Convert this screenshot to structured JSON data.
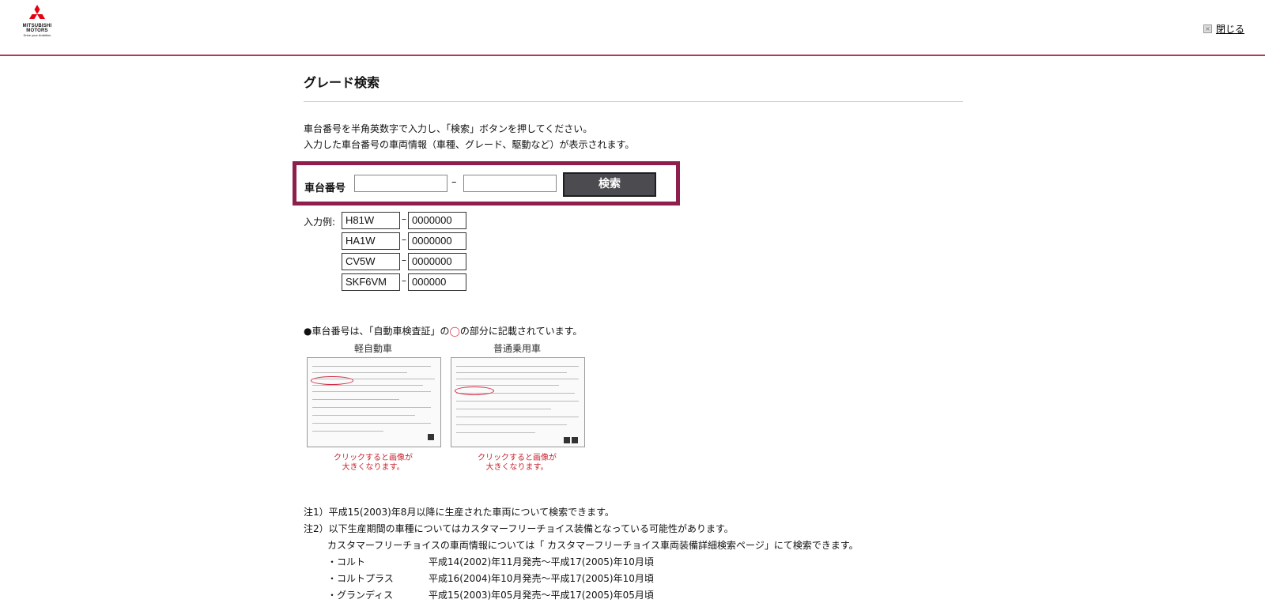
{
  "header": {
    "brand": "MITSUBISHI\nMOTORS",
    "brand_line1": "MITSUBISHI",
    "brand_line2": "MOTORS",
    "tagline": "Drive your Ambition",
    "close_label": "閉じる",
    "accent_color": "#b03a5b"
  },
  "page": {
    "title": "グレード検索",
    "intro_line1": "車台番号を半角英数字で入力し、「検索」ボタンを押してください。",
    "intro_line2": "入力した車台番号の車両情報（車種、グレード、駆動など）が表示されます。"
  },
  "search": {
    "label": "車台番号",
    "field1_value": "",
    "field2_value": "",
    "separator": "–",
    "button_label": "検索",
    "box_color": "#8e1f4c"
  },
  "examples": {
    "label": "入力例:",
    "rows": [
      {
        "prefix": "H81W",
        "number": "0000000"
      },
      {
        "prefix": "HA1W",
        "number": "0000000"
      },
      {
        "prefix": "CV5W",
        "number": "0000000"
      },
      {
        "prefix": "SKF6VM",
        "number": "000000"
      }
    ]
  },
  "certificate": {
    "heading_pre": "●車台番号は、「自動車検査証」の",
    "heading_mark": "◯",
    "heading_post": "の部分に記載されています。",
    "items": [
      {
        "title": "軽自動車",
        "caption1": "クリックすると画像が",
        "caption2": "大きくなります。"
      },
      {
        "title": "普通乗用車",
        "caption1": "クリックすると画像が",
        "caption2": "大きくなります。"
      }
    ]
  },
  "notes": {
    "note1": "注1）平成15(2003)年8月以降に生産された車両について検索できます。",
    "note2": "注2）以下生産期間の車種についてはカスタマーフリーチョイス装備となっている可能性があります。",
    "note2_sub": "カスタマーフリーチョイスの車両情報については「 カスタマーフリーチョイス車両装備詳細検索ページ」にて検索できます。",
    "models": [
      {
        "name": "・コルト",
        "period": "平成14(2002)年11月発売～平成17(2005)年10月頃"
      },
      {
        "name": "・コルトプラス",
        "period": "平成16(2004)年10月発売～平成17(2005)年10月頃"
      },
      {
        "name": "・グランディス",
        "period": "平成15(2003)年05月発売～平成17(2005)年05月頃"
      }
    ]
  }
}
